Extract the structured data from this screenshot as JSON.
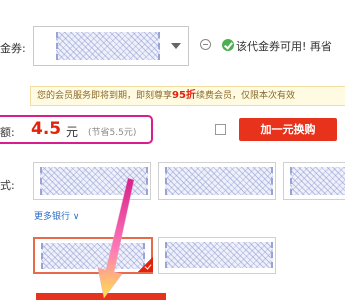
{
  "voucher": {
    "label": "金券:",
    "status_text": "该代金券可用! 再省"
  },
  "notice": {
    "text_before": "您的会员服务即将到期，即刻尊享",
    "highlight": "95折",
    "text_after": "续费会员，仅限本次有效"
  },
  "amount": {
    "label": "额:",
    "value": "4.5",
    "unit": "元",
    "saving": "(节省5.5元)"
  },
  "upgrade": {
    "button_label": "加一元换购"
  },
  "payment": {
    "label": "式:",
    "more_banks": "更多银行 ∨"
  },
  "colors": {
    "price_red": "#e3220b",
    "annotation_pink": "#d61f8c",
    "button_red": "#e8331c",
    "link_blue": "#2a6fc9"
  },
  "icons": [
    "minus-circle-icon",
    "check-circle-icon",
    "chevron-down-icon",
    "selected-check-icon",
    "annotation-arrow"
  ]
}
